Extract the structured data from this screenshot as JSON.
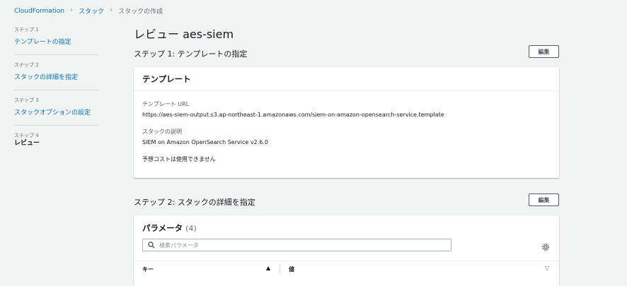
{
  "breadcrumb": {
    "items": [
      "CloudFormation",
      "スタック"
    ],
    "current": "スタックの作成"
  },
  "nav": {
    "steps": [
      {
        "label": "ステップ 1",
        "title": "テンプレートの指定"
      },
      {
        "label": "ステップ 2",
        "title": "スタックの詳細を指定"
      },
      {
        "label": "ステップ 3",
        "title": "スタックオプションの設定"
      },
      {
        "label": "ステップ 4",
        "title": "レビュー"
      }
    ]
  },
  "page_title": "レビュー aes-siem",
  "section1": {
    "heading": "ステップ 1: テンプレートの指定",
    "edit_label": "編集",
    "card_title": "テンプレート",
    "template_url_label": "テンプレート URL",
    "template_url": "https://aes-siem-output.s3.ap-northeast-1.amazonaws.com/siem-on-amazon-opensearch-service.template",
    "description_label": "スタックの説明",
    "description": "SIEM on Amazon OpenSearch Service v2.6.0",
    "cost_text": "予想コストは使用できません"
  },
  "section2": {
    "heading": "ステップ 2: スタックの詳細を指定",
    "edit_label": "編集",
    "params_title": "パラメータ",
    "params_count": "(4)",
    "search_placeholder": "検索パラメータ",
    "col_key": "キー",
    "col_value": "値"
  },
  "colors": {
    "link": "#0073bb",
    "background": "#f2f3f3"
  }
}
